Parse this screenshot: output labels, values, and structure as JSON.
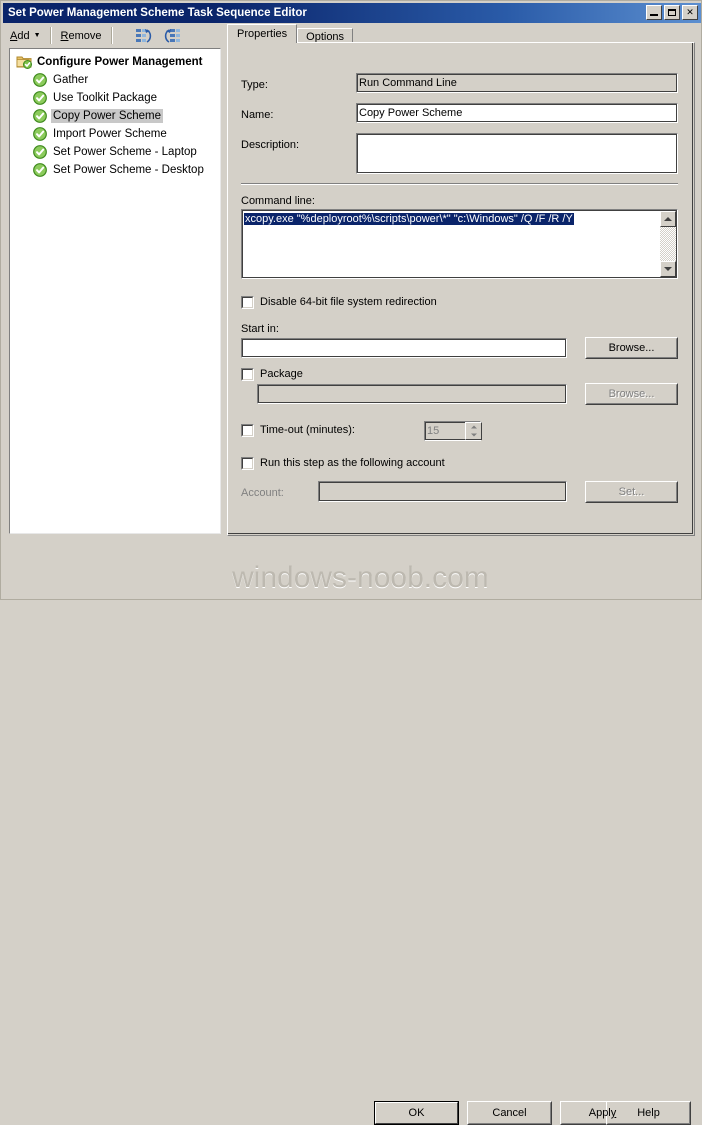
{
  "window": {
    "title": "Set Power Management Scheme Task Sequence Editor",
    "buttons": {
      "minimize": "minimize-icon",
      "maximize": "maximize-icon",
      "close": "✕"
    }
  },
  "toolbar": {
    "add_label": "Add",
    "add_arrow": "▼",
    "remove_label": "Remove",
    "icon_move_up": "move-up-icon",
    "icon_move_down": "move-down-icon"
  },
  "tree": {
    "root": {
      "label": "Configure Power Management",
      "icon": "folder-check-icon"
    },
    "items": [
      {
        "label": "Gather",
        "icon": "green-check-icon",
        "selected": false
      },
      {
        "label": "Use Toolkit Package",
        "icon": "green-check-icon",
        "selected": false
      },
      {
        "label": "Copy Power Scheme",
        "icon": "green-check-icon",
        "selected": true
      },
      {
        "label": "Import Power Scheme",
        "icon": "green-check-icon",
        "selected": false
      },
      {
        "label": "Set Power Scheme - Laptop",
        "icon": "green-check-icon",
        "selected": false
      },
      {
        "label": "Set Power Scheme - Desktop",
        "icon": "green-check-icon",
        "selected": false
      }
    ]
  },
  "tabs": [
    {
      "label": "Properties",
      "active": true
    },
    {
      "label": "Options",
      "active": false
    }
  ],
  "properties": {
    "type_label": "Type:",
    "type_value": "Run Command Line",
    "name_label": "Name:",
    "name_value": "Copy Power Scheme",
    "description_label": "Description:",
    "description_value": "",
    "command_line_label": "Command line:",
    "command_line_value": "xcopy.exe \"%deployroot%\\scripts\\power\\*\" \"c:\\Windows\" /Q /F /R /Y",
    "disable_redirection_label": "Disable 64-bit file system redirection",
    "disable_redirection_checked": false,
    "start_in_label": "Start in:",
    "start_in_value": "",
    "start_in_browse_label": "Browse...",
    "package_label": "Package",
    "package_checked": false,
    "package_value": "",
    "package_browse_label": "Browse...",
    "timeout_label": "Time-out (minutes):",
    "timeout_checked": false,
    "timeout_value": "15",
    "run_as_label": "Run this step as the following account",
    "run_as_checked": false,
    "account_label": "Account:",
    "account_value": "",
    "account_set_label": "Set..."
  },
  "footer": {
    "ok_label": "OK",
    "cancel_label": "Cancel",
    "apply_label": "Apply",
    "apply_accel": "y",
    "help_label": "Help"
  },
  "watermark": {
    "text": "windows-noob.com"
  },
  "colors": {
    "titlebar_start": "#0a246a",
    "titlebar_end": "#5c8fd0",
    "face": "#d4d0c8",
    "selection": "#0a246a",
    "tree_selection": "#c8c8c8",
    "disabled_text": "#808080",
    "icon_green": "#4ca832",
    "watermark": "#bdb9b0"
  }
}
